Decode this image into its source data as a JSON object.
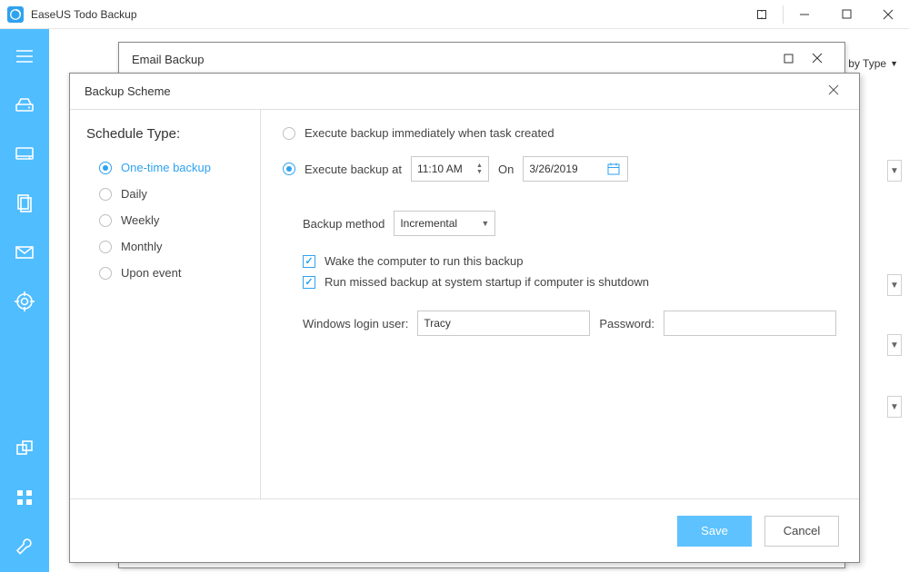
{
  "app": {
    "title": "EaseUS Todo Backup"
  },
  "topbar": {
    "sort_label": "Sort by Type"
  },
  "email_window": {
    "title": "Email Backup"
  },
  "scheme_window": {
    "title": "Backup Scheme",
    "schedule_type_heading": "Schedule Type:",
    "schedule_options": {
      "one_time": "One-time backup",
      "daily": "Daily",
      "weekly": "Weekly",
      "monthly": "Monthly",
      "upon_event": "Upon event"
    },
    "exec_immediate_label": "Execute backup immediately when task created",
    "exec_at_label": "Execute backup at",
    "time_value": "11:10 AM",
    "on_label": "On",
    "date_value": "3/26/2019",
    "method_label": "Backup method",
    "method_value": "Incremental",
    "wake_label": "Wake the computer to run this backup",
    "missed_label": "Run missed backup at system startup if computer is shutdown",
    "user_label": "Windows login user:",
    "user_value": "Tracy",
    "password_label": "Password:",
    "password_value": "",
    "save_label": "Save",
    "cancel_label": "Cancel"
  }
}
